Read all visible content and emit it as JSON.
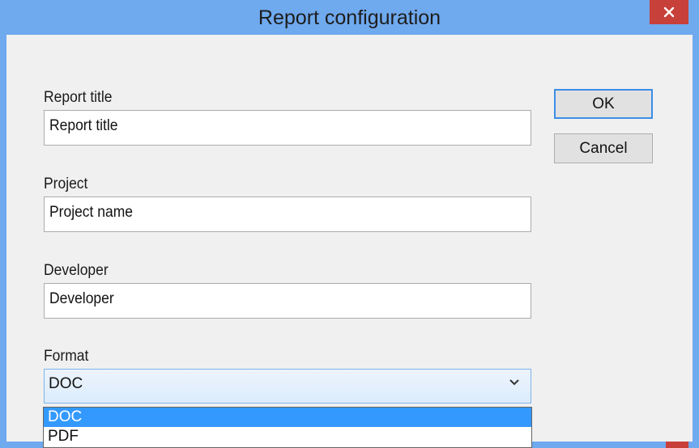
{
  "window": {
    "title": "Report configuration"
  },
  "fields": {
    "report_title": {
      "label": "Report title",
      "value": "Report title"
    },
    "project": {
      "label": "Project",
      "value": "Project name"
    },
    "developer": {
      "label": "Developer",
      "value": "Developer"
    }
  },
  "format": {
    "label": "Format",
    "selected": "DOC",
    "options": [
      "DOC",
      "PDF"
    ],
    "highlighted_index": 0
  },
  "buttons": {
    "ok": "OK",
    "cancel": "Cancel"
  },
  "icons": {
    "close": "close-icon",
    "dropdown": "chevron-down-icon"
  },
  "colors": {
    "title_bar": "#6fa9ee",
    "close_button": "#c7403a",
    "selection": "#3399ff",
    "dialog_background": "#f0f0f0"
  }
}
